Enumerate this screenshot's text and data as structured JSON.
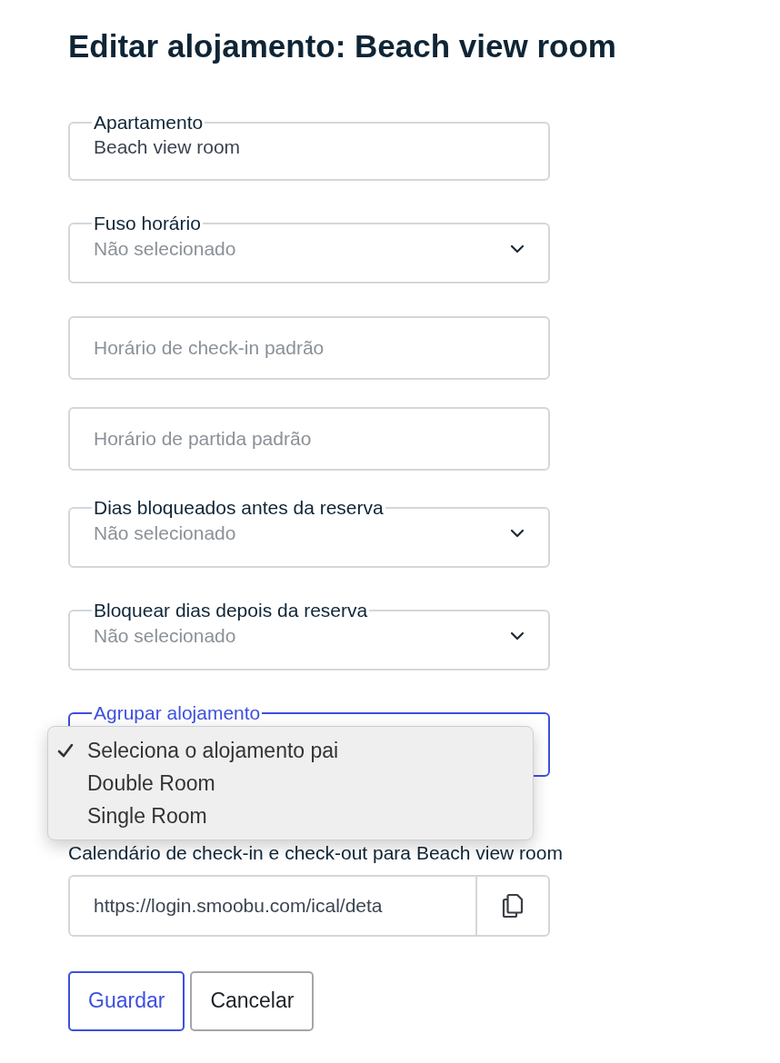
{
  "title": "Editar alojamento: Beach view room",
  "fields": [
    {
      "kind": "text",
      "label": "Apartamento",
      "value": "Beach view room",
      "focused": false
    },
    {
      "kind": "select",
      "label": "Fuso horário",
      "placeholder": "Não selecionado",
      "focused": false
    },
    {
      "kind": "input",
      "placeholder": "Horário de check-in padrão",
      "focused": false
    },
    {
      "kind": "input",
      "placeholder": "Horário de partida padrão",
      "focused": false
    },
    {
      "kind": "select",
      "label": "Dias bloqueados antes da reserva",
      "placeholder": "Não selecionado",
      "focused": false
    },
    {
      "kind": "select",
      "label": "Bloquear dias depois da reserva",
      "placeholder": "Não selecionado",
      "focused": false
    },
    {
      "kind": "select",
      "label": "Agrupar alojamento",
      "focused": true,
      "menu": [
        {
          "label": "Seleciona o alojamento pai",
          "selected": true
        },
        {
          "label": "Double Room",
          "selected": false
        },
        {
          "label": "Single Room",
          "selected": false
        }
      ]
    }
  ],
  "calendar": {
    "label": "Calendário de check-in e check-out para Beach view room",
    "url": "https://login.smoobu.com/ical/deta"
  },
  "buttons": [
    {
      "label": "Guardar",
      "kind": "primary"
    },
    {
      "label": "Cancelar",
      "kind": "secondary"
    }
  ]
}
